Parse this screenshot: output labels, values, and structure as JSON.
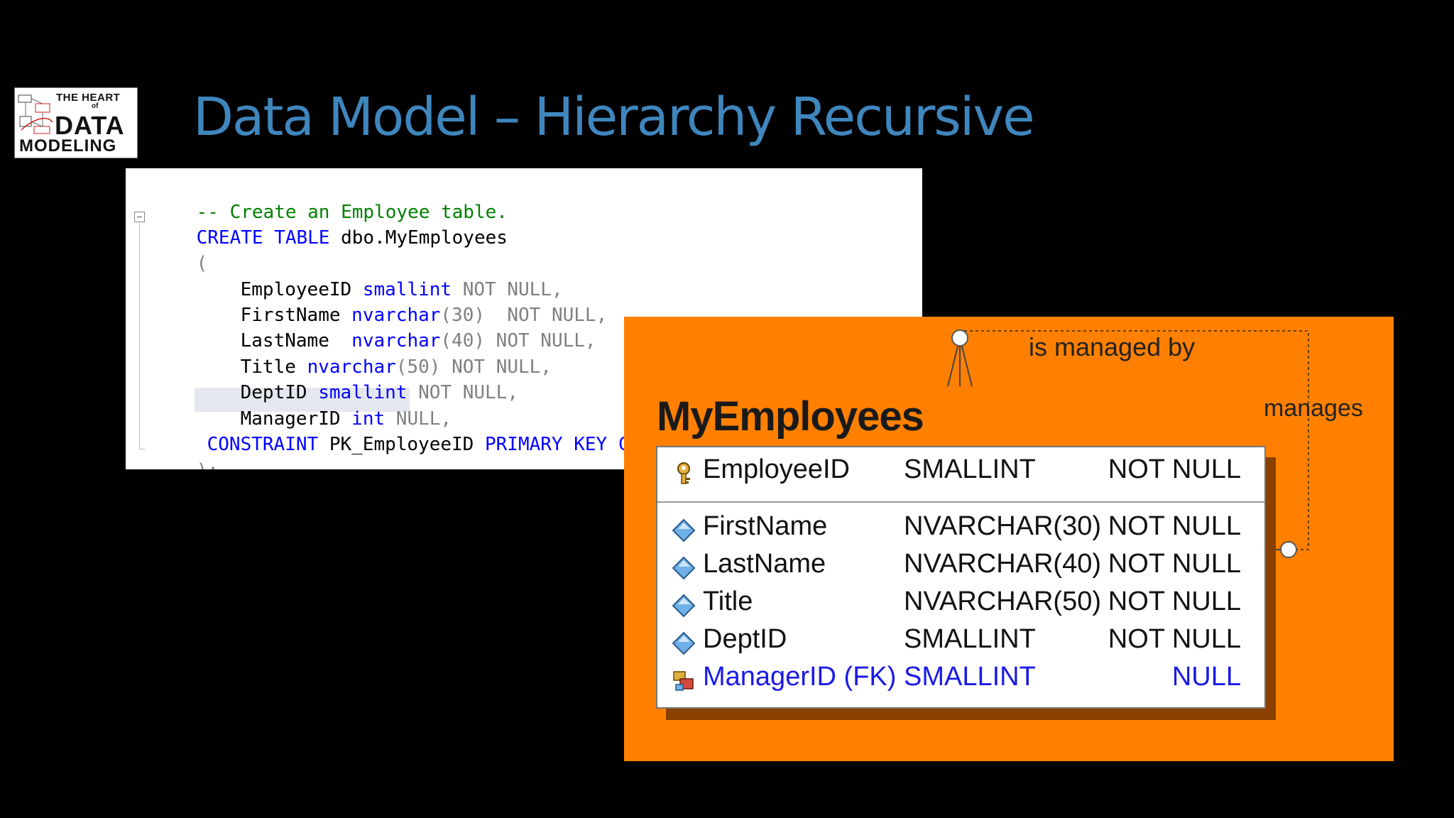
{
  "logo": {
    "line1": "THE HEART",
    "line2": "of",
    "line3": "DATA",
    "line4": "MODELING"
  },
  "slide": {
    "title": "Data Model – Hierarchy Recursive"
  },
  "code": {
    "comment": "-- Create an Employee table.",
    "create_kw": "CREATE TABLE",
    "create_name": " dbo.MyEmployees",
    "open_paren": "(",
    "close_paren": ");",
    "columns": [
      {
        "name": "EmployeeID",
        "sep": " ",
        "type": "smallint",
        "args": "",
        "null": " NOT NULL,"
      },
      {
        "name": "FirstName",
        "sep": " ",
        "type": "nvarchar",
        "args": "(30)",
        "null": "  NOT NULL,"
      },
      {
        "name": "LastName",
        "sep": "  ",
        "type": "nvarchar",
        "args": "(40)",
        "null": " NOT NULL,"
      },
      {
        "name": "Title",
        "sep": " ",
        "type": "nvarchar",
        "args": "(50)",
        "null": " NOT NULL,"
      },
      {
        "name": "DeptID",
        "sep": " ",
        "type": "smallint",
        "args": "",
        "null": " NOT NULL,"
      },
      {
        "name": "ManagerID",
        "sep": " ",
        "type": "int",
        "args": "",
        "null": " NULL,"
      }
    ],
    "constraint": {
      "kw1": "CONSTRAINT",
      "name": " PK_EmployeeID ",
      "kw2": "PRIMARY KEY CLUS"
    }
  },
  "diagram": {
    "entity": "MyEmployees",
    "relationship_label": "is managed by",
    "relationship_label_2": "manages",
    "primary_key": {
      "name": "EmployeeID",
      "type": "SMALLINT",
      "null": "NOT NULL",
      "icon": "key-icon"
    },
    "attributes": [
      {
        "name": "FirstName",
        "type": "NVARCHAR(30)",
        "null": "NOT NULL",
        "icon": "diamond-icon"
      },
      {
        "name": "LastName",
        "type": "NVARCHAR(40)",
        "null": "NOT NULL",
        "icon": "diamond-icon"
      },
      {
        "name": "Title",
        "type": "NVARCHAR(50)",
        "null": "NOT NULL",
        "icon": "diamond-icon"
      },
      {
        "name": "DeptID",
        "type": "SMALLINT",
        "null": "NOT NULL",
        "icon": "diamond-icon"
      },
      {
        "name": "ManagerID (FK)",
        "type": "SMALLINT",
        "null": "NULL",
        "icon": "foreign-key-icon"
      }
    ],
    "colors": {
      "background": "#ff8000",
      "fk_text": "#1a1ae6",
      "title": "#3f86bd"
    }
  }
}
